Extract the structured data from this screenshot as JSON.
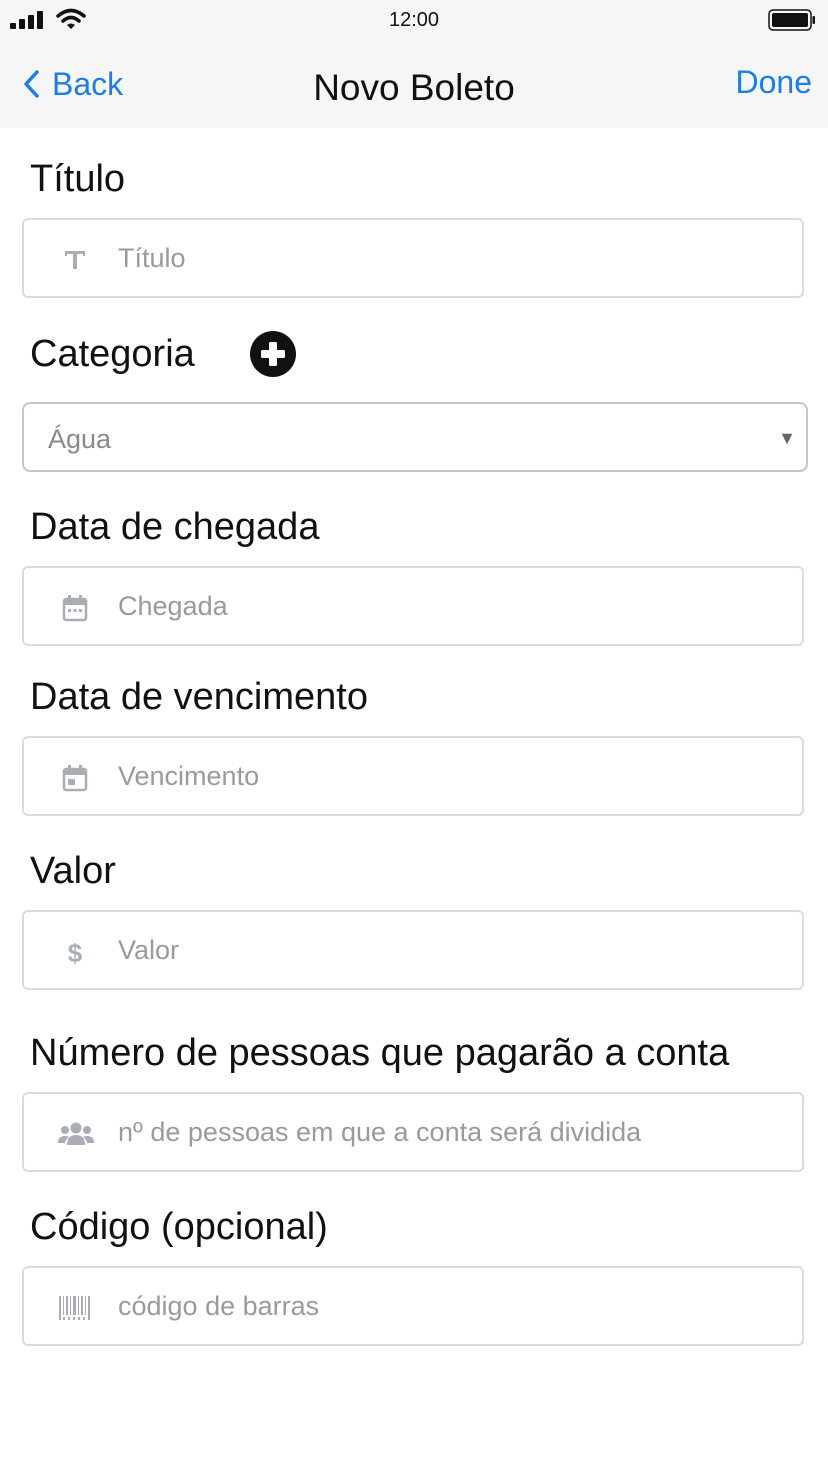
{
  "status_bar": {
    "time": "12:00"
  },
  "nav": {
    "back_label": "Back",
    "title": "Novo Boleto",
    "done_label": "Done",
    "accent_color": "#1a7ee6"
  },
  "form": {
    "title_field": {
      "label": "Título",
      "placeholder": "Título",
      "icon": "text-icon"
    },
    "category_field": {
      "label": "Categoria",
      "selected_value": "Água",
      "add_icon": "plus-circle-icon"
    },
    "arrival_date_field": {
      "label": "Data de chegada",
      "placeholder": "Chegada",
      "icon": "calendar-icon"
    },
    "due_date_field": {
      "label": "Data de vencimento",
      "placeholder": "Vencimento",
      "icon": "calendar-icon"
    },
    "amount_field": {
      "label": "Valor",
      "placeholder": "Valor",
      "icon": "dollar-icon"
    },
    "people_field": {
      "label": "Número de pessoas que pagarão a conta",
      "placeholder": "nº de pessoas em que a conta será dividida",
      "icon": "users-icon"
    },
    "code_field": {
      "label": "Código (opcional)",
      "placeholder": "código de barras",
      "icon": "barcode-icon"
    }
  }
}
